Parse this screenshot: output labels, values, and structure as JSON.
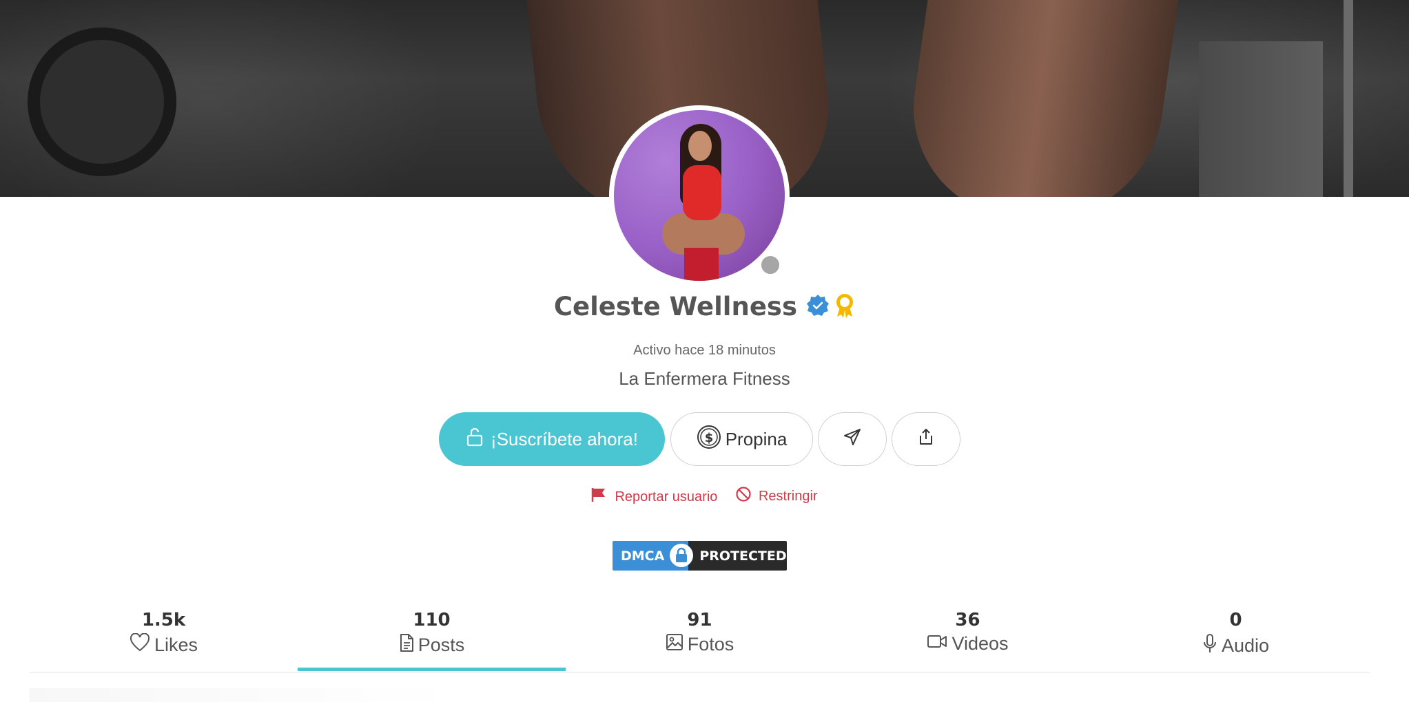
{
  "profile": {
    "name": "Celeste Wellness",
    "last_active": "Activo hace 18 minutos",
    "bio": "La Enfermera Fitness",
    "verified_icon": "verified-badge-icon",
    "award_icon": "award-ribbon-icon",
    "status": "offline"
  },
  "buttons": {
    "subscribe_label": "¡Suscríbete ahora!",
    "tip_label": "Propina"
  },
  "actions": {
    "report_label": "Reportar usuario",
    "restrict_label": "Restringir"
  },
  "dmca": {
    "left": "DMCA",
    "right": "PROTECTED"
  },
  "stats": [
    {
      "count": "1.5k",
      "label": "Likes",
      "icon": "heart-icon"
    },
    {
      "count": "110",
      "label": "Posts",
      "icon": "document-icon",
      "active": true
    },
    {
      "count": "91",
      "label": "Fotos",
      "icon": "image-icon"
    },
    {
      "count": "36",
      "label": "Videos",
      "icon": "video-camera-icon"
    },
    {
      "count": "0",
      "label": "Audio",
      "icon": "microphone-icon"
    }
  ],
  "colors": {
    "accent": "#49c6d1",
    "danger": "#d03a4a",
    "verified": "#3b8fd6",
    "award": "#f5b800"
  }
}
